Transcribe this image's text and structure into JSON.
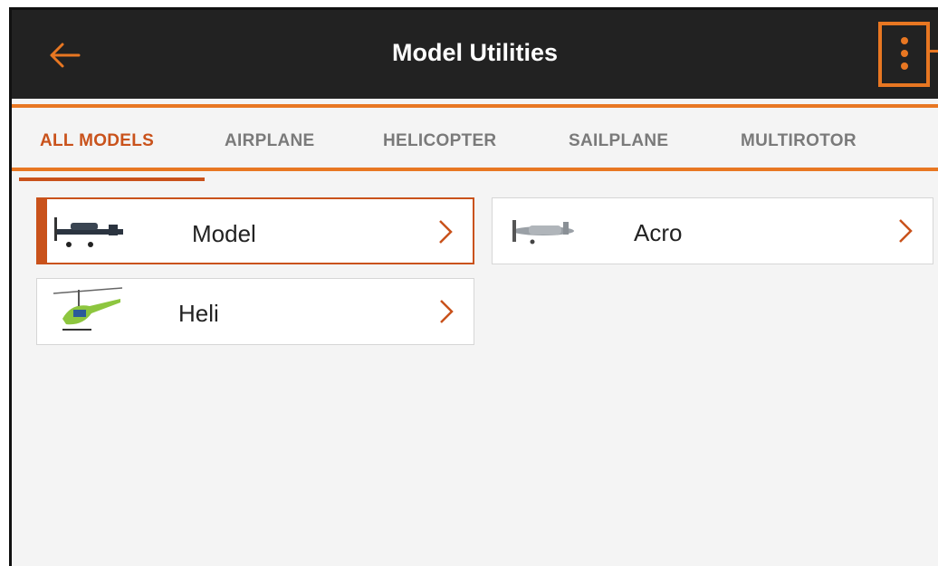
{
  "appbar": {
    "title": "Model Utilities"
  },
  "tabs": [
    {
      "label": "ALL MODELS",
      "active": true
    },
    {
      "label": "AIRPLANE",
      "active": false
    },
    {
      "label": "HELICOPTER",
      "active": false
    },
    {
      "label": "SAILPLANE",
      "active": false
    },
    {
      "label": "MULTIROTOR",
      "active": false
    }
  ],
  "models": [
    {
      "name": "Model",
      "selected": true,
      "thumb": "warbird-airplane-photo"
    },
    {
      "name": "Acro",
      "selected": false,
      "thumb": "p51-airplane-photo"
    },
    {
      "name": "Heli",
      "selected": false,
      "thumb": "green-helicopter-photo"
    }
  ],
  "colors": {
    "accent": "#e87722",
    "active_tab": "#c9521b",
    "appbar_bg": "#222222"
  },
  "icons": {
    "back": "arrow-left-icon",
    "menu": "overflow-menu-icon",
    "chevron": "chevron-right-icon"
  }
}
